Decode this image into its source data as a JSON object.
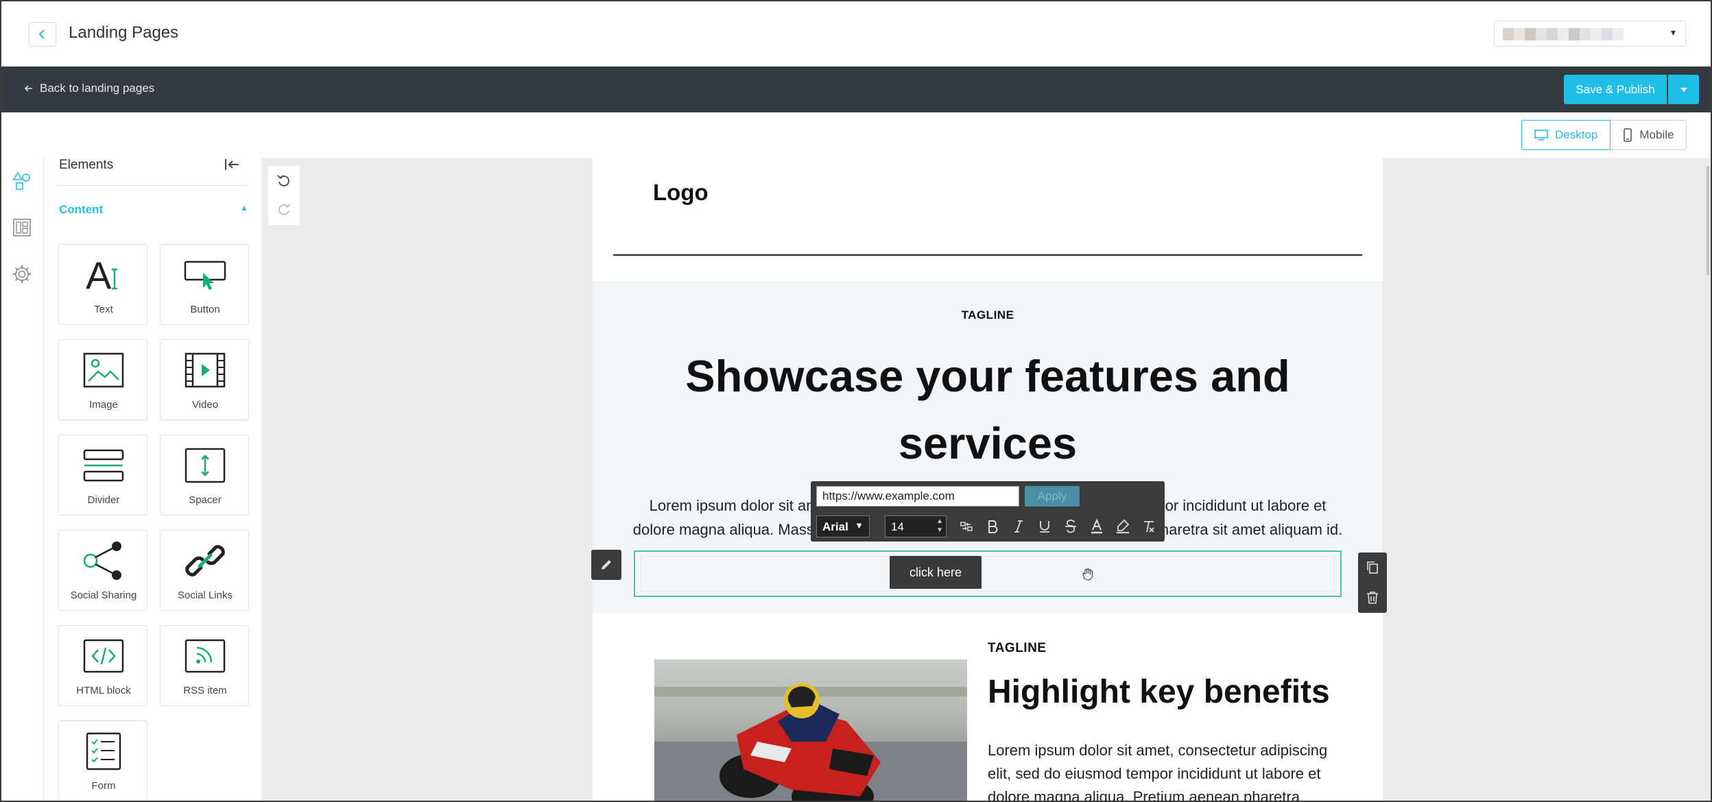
{
  "header": {
    "title": "Landing Pages",
    "back_icon": "chevron-left-icon",
    "account_select": {
      "value_blurred": true,
      "caret": "▾"
    }
  },
  "toolbar": {
    "back_link": "Back to landing pages",
    "publish_label": "Save & Publish",
    "accent": "#1fbfe8",
    "bg": "#343a40"
  },
  "device_toggle": {
    "desktop": "Desktop",
    "mobile": "Mobile",
    "active": "Desktop"
  },
  "rail": {
    "items": [
      "shapes-icon",
      "layout-icon",
      "settings-icon"
    ]
  },
  "elements_panel": {
    "title": "Elements",
    "section": "Content",
    "tiles": [
      {
        "label": "Text",
        "icon": "text-icon"
      },
      {
        "label": "Button",
        "icon": "button-icon"
      },
      {
        "label": "Image",
        "icon": "image-icon"
      },
      {
        "label": "Video",
        "icon": "video-icon"
      },
      {
        "label": "Divider",
        "icon": "divider-icon"
      },
      {
        "label": "Spacer",
        "icon": "spacer-icon"
      },
      {
        "label": "Social Sharing",
        "icon": "share-icon"
      },
      {
        "label": "Social Links",
        "icon": "link-icon"
      },
      {
        "label": "HTML block",
        "icon": "code-icon"
      },
      {
        "label": "RSS item",
        "icon": "rss-icon"
      },
      {
        "label": "Form",
        "icon": "form-icon"
      }
    ]
  },
  "page": {
    "logo": "Logo",
    "hero": {
      "tagline": "TAGLINE",
      "heading": "Showcase your features and services",
      "body": "Lorem ipsum dolor sit amet, consectetur adipiscing elit, sed do eiusmod tempor incididunt ut labore et dolore magna aliqua. Massa tempor nec feugiat nisl pretium. Pretium aenean pharetra sit amet aliquam id.",
      "button_label": "click here"
    },
    "section2": {
      "tagline": "TAGLINE",
      "heading": "Highlight key benefits",
      "body": "Lorem ipsum dolor sit amet, consectetur adipiscing elit, sed do eiusmod tempor incididunt ut labore et dolore magna aliqua. Pretium aenean pharetra"
    }
  },
  "format_bar": {
    "url_value": "https://www.example.com",
    "apply_label": "Apply",
    "font_family": "Arial",
    "font_size": "14",
    "tools": [
      "link-break-icon",
      "bold-icon",
      "italic-icon",
      "underline-icon",
      "strikethrough-icon",
      "text-color-icon",
      "highlight-icon",
      "clear-format-icon"
    ]
  }
}
